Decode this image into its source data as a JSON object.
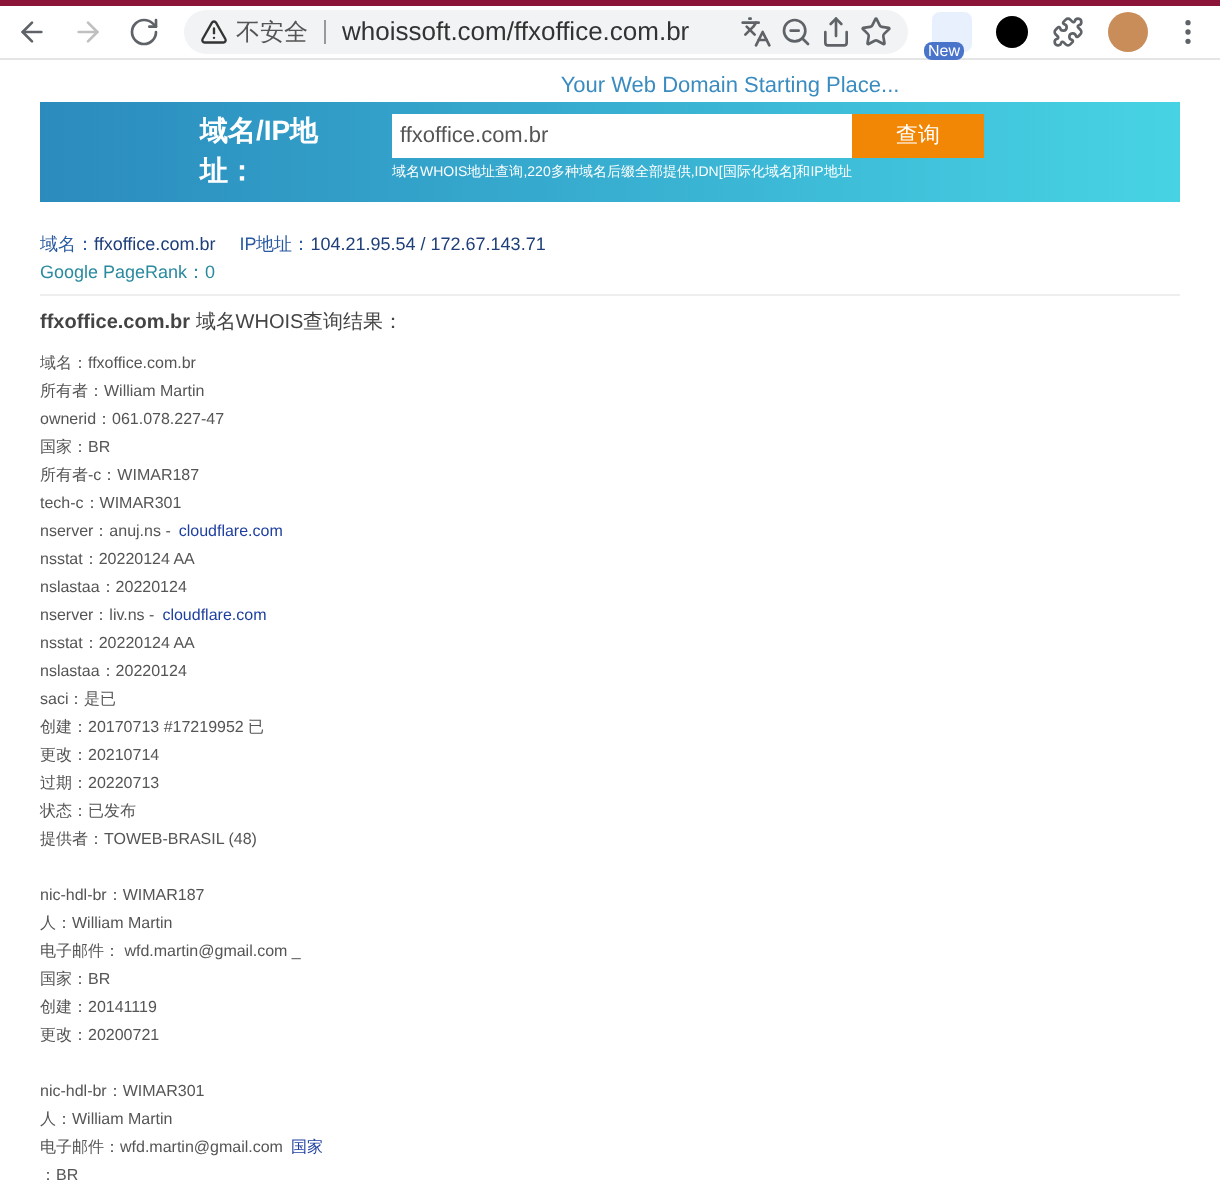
{
  "browser": {
    "security": "不安全",
    "url": "whoissoft.com/ffxoffice.com.br",
    "badge": "New"
  },
  "tagline": "Your Web Domain Starting Place...",
  "search": {
    "label": "域名/IP地址：",
    "value": "ffxoffice.com.br",
    "button": "查询",
    "hint": "域名WHOIS地址查询,220多种域名后缀全部提供,IDN[国际化域名]和IP地址"
  },
  "summary": [
    {
      "label": "域名：",
      "value": "ffxoffice.com.br"
    },
    {
      "label": "IP地址：",
      "value": "104.21.95.54 / 172.67.143.71"
    }
  ],
  "pagerank": "Google PageRank：0",
  "result_title": {
    "domain": "ffxoffice.com.br",
    "suffix": "域名WHOIS查询结果："
  },
  "groups": [
    {
      "lines": [
        {
          "text": "域名：ffxoffice.com.br"
        },
        {
          "text": "所有者：William Martin"
        },
        {
          "text": "ownerid：061.078.227-47"
        },
        {
          "text": "国家：BR"
        },
        {
          "text": "所有者-c：WIMAR187"
        },
        {
          "text": "tech-c：WIMAR301"
        },
        {
          "text": "nserver：anuj.ns -",
          "link": "cloudflare.com"
        },
        {
          "text": "nsstat：20220124 AA"
        },
        {
          "text": "nslastaa：20220124"
        },
        {
          "text": "nserver：liv.ns -",
          "link": "cloudflare.com"
        },
        {
          "text": "nsstat：20220124 AA"
        },
        {
          "text": "nslastaa：20220124"
        },
        {
          "text": "saci：是已"
        },
        {
          "text": "创建：20170713 #17219952 已"
        },
        {
          "text": "更改：20210714"
        },
        {
          "text": "过期：20220713"
        },
        {
          "text": "状态：已发布"
        },
        {
          "text": "提供者：TOWEB-BRASIL (48)"
        }
      ]
    },
    {
      "lines": [
        {
          "text": "nic-hdl-br：WIMAR187"
        },
        {
          "text": "人：William Martin"
        },
        {
          "text": "电子邮件： wfd.martin@gmail.com _"
        },
        {
          "text": "国家：BR"
        },
        {
          "text": "创建：20141119"
        },
        {
          "text": "更改：20200721"
        }
      ]
    },
    {
      "lines": [
        {
          "text": "nic-hdl-br：WIMAR301"
        },
        {
          "text": "人：William Martin"
        },
        {
          "text": "电子邮件：wfd.martin@gmail.com",
          "link": "国家"
        },
        {
          "text": "：BR"
        }
      ]
    }
  ]
}
